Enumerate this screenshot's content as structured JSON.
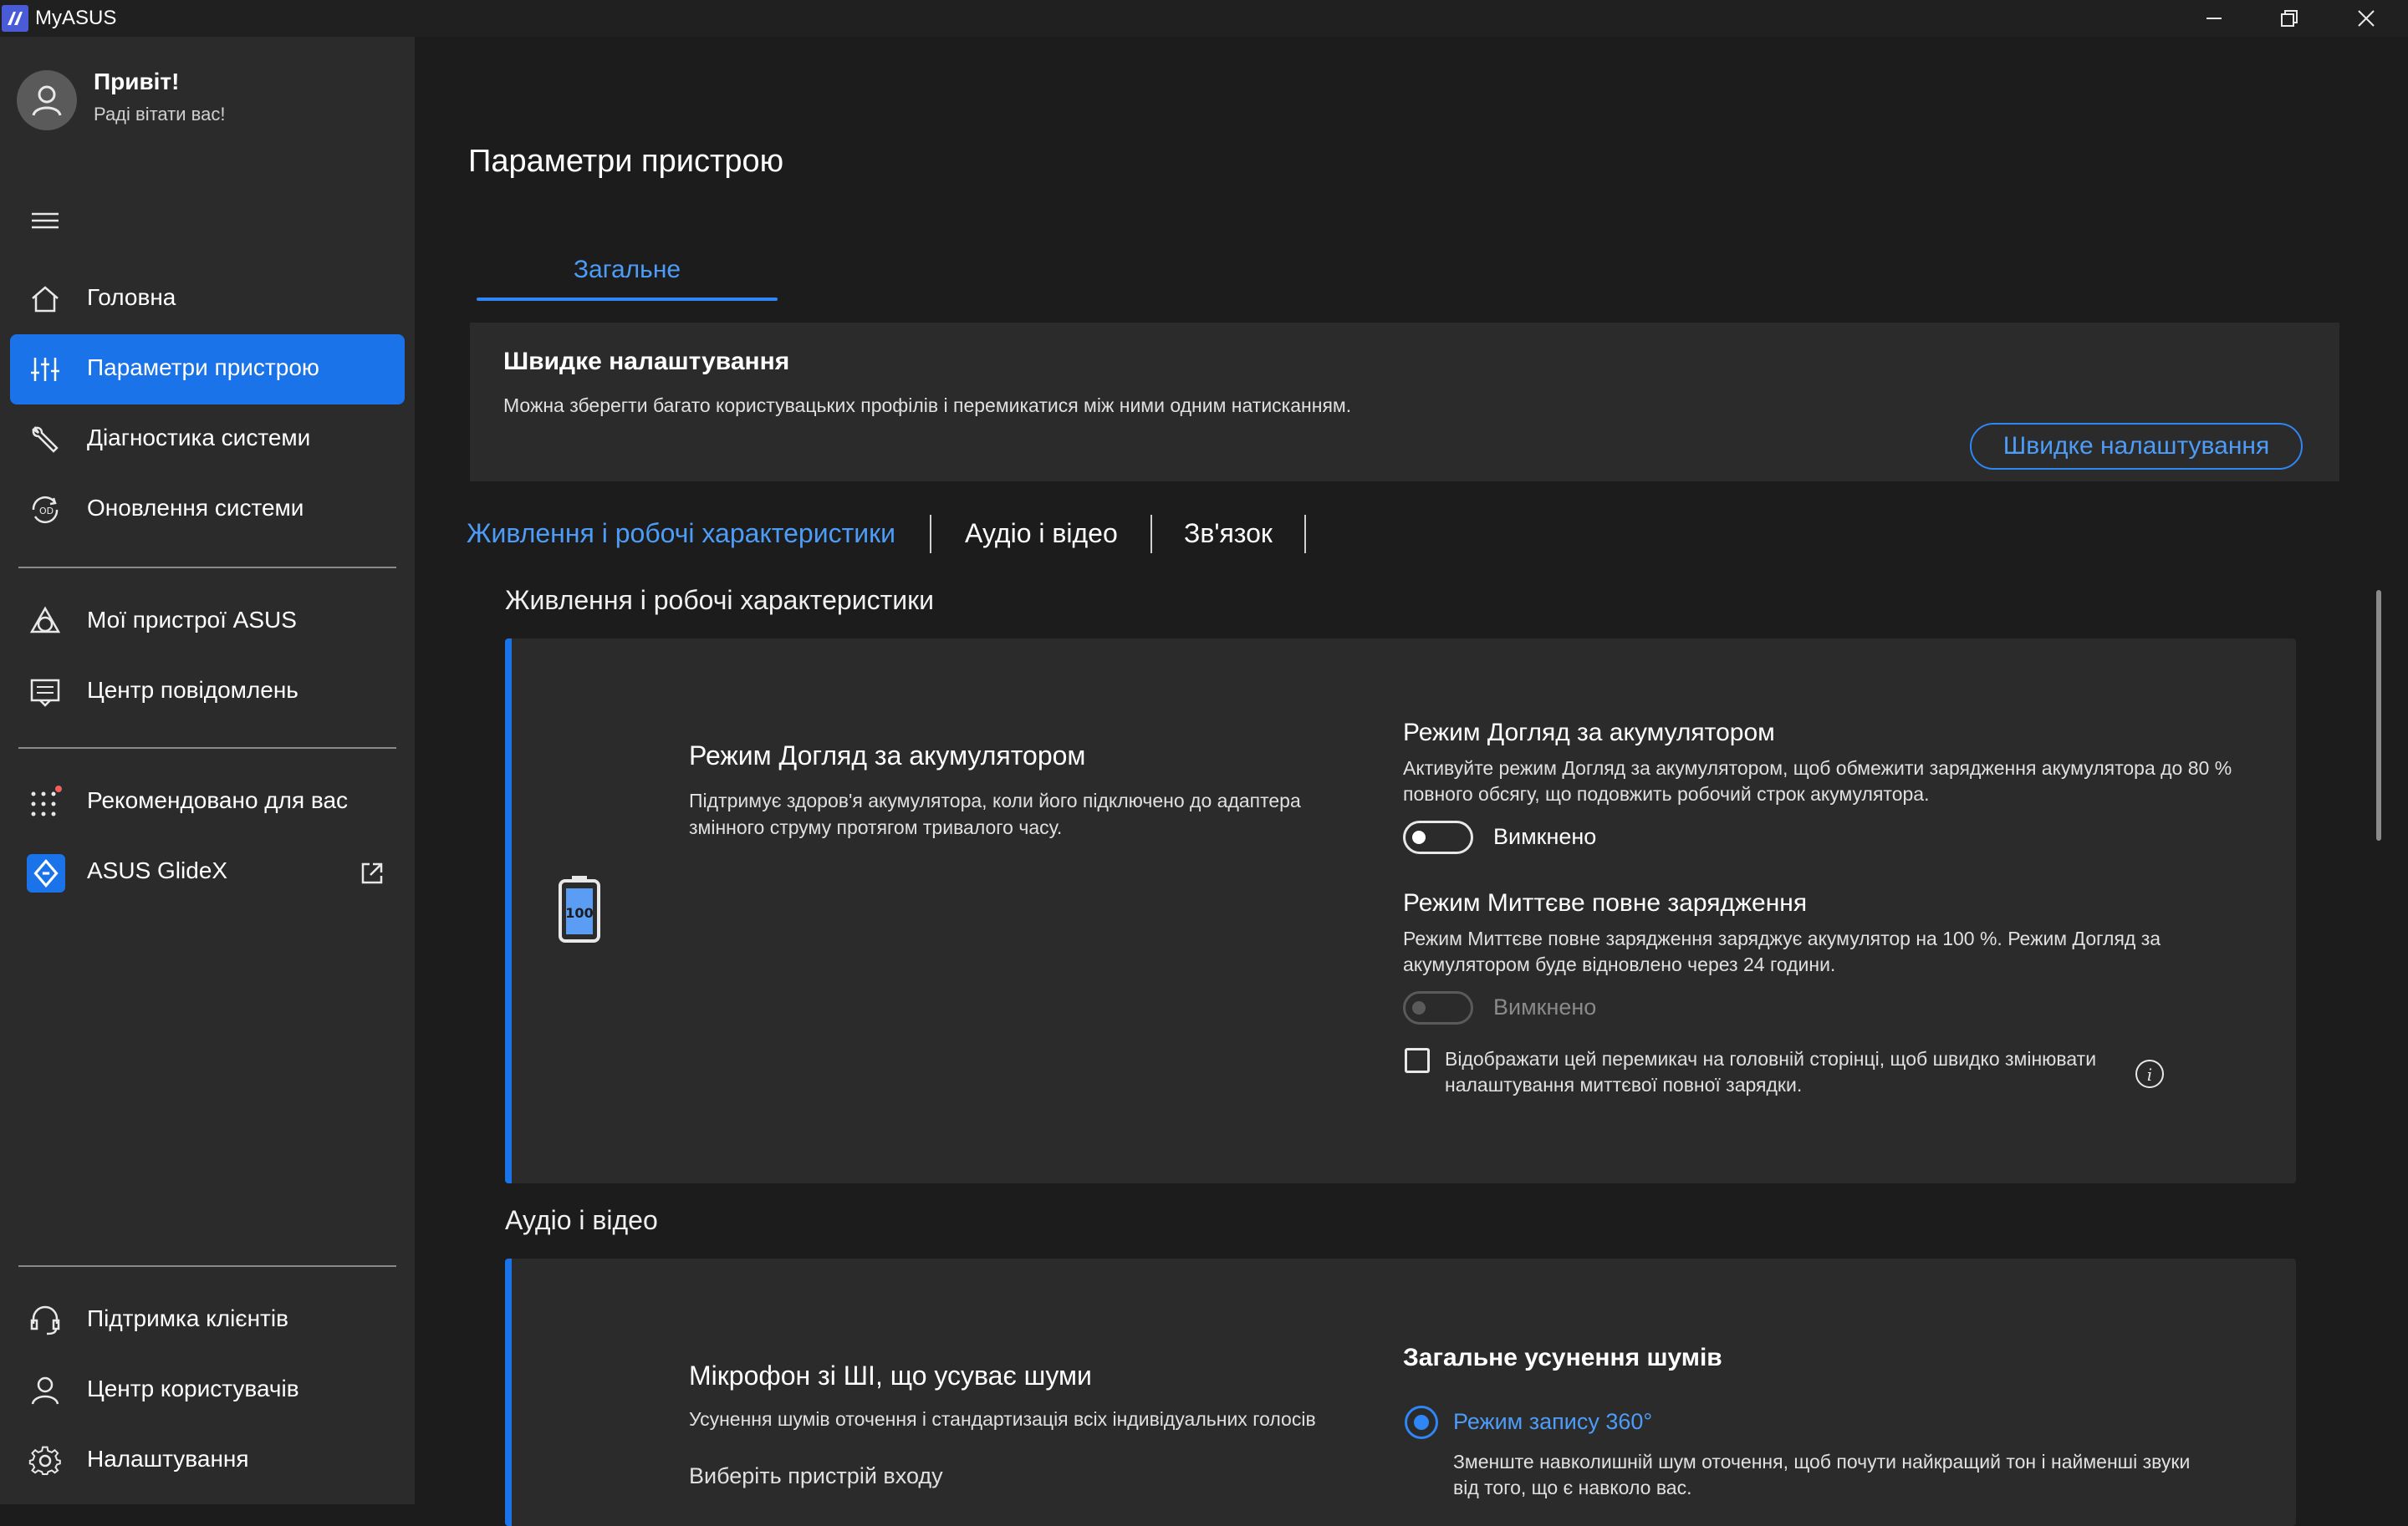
{
  "window": {
    "title": "MyASUS",
    "controls": [
      "minimize",
      "restore",
      "close"
    ]
  },
  "sidebar": {
    "greeting_title": "Привіт!",
    "greeting_sub": "Раді вітати вас!",
    "items": [
      {
        "label": "Головна",
        "icon": "home-icon",
        "active": false
      },
      {
        "label": "Параметри пристрою",
        "icon": "sliders-icon",
        "active": true
      },
      {
        "label": "Діагностика системи",
        "icon": "wrench-icon",
        "active": false
      },
      {
        "label": "Оновлення системи",
        "icon": "update-icon",
        "active": false
      },
      {
        "label": "Мої пристрої ASUS",
        "icon": "devices-icon",
        "active": false
      },
      {
        "label": "Центр повідомлень",
        "icon": "message-icon",
        "active": false
      },
      {
        "label": "Рекомендовано для вас",
        "icon": "grid-dots-icon",
        "active": false,
        "badge": true
      },
      {
        "label": "ASUS GlideX",
        "icon": "glidex-icon",
        "active": false,
        "external": true
      },
      {
        "label": "Підтримка клієнтів",
        "icon": "headset-icon",
        "active": false
      },
      {
        "label": "Центр користувачів",
        "icon": "user-icon",
        "active": false
      },
      {
        "label": "Налаштування",
        "icon": "gear-icon",
        "active": false
      }
    ]
  },
  "main": {
    "page_title": "Параметри пристрою",
    "tab_general": "Загальне",
    "quick": {
      "title": "Швидке налаштування",
      "description": "Можна зберегти багато користувацьких профілів і перемикатися між ними одним натисканням.",
      "button": "Швидке налаштування"
    },
    "subtabs": [
      "Живлення і робочі характеристики",
      "Аудіо і відео",
      "Зв'язок"
    ],
    "power_section": {
      "title": "Живлення і робочі характеристики",
      "feature_title": "Режим Догляд за акумулятором",
      "feature_desc": "Підтримує здоров'я акумулятора, коли його підключено до адаптера змінного струму протягом тривалого часу.",
      "battery_value": "100",
      "care_title": "Режим Догляд за акумулятором",
      "care_desc": "Активуйте режим Догляд за акумулятором, щоб обмежити зарядження акумулятора до 80 % повного обсягу, що подовжить робочий строк акумулятора.",
      "care_toggle": "Вимкнено",
      "instant_title": "Режим Миттєве повне зарядження",
      "instant_desc": "Режим Миттєве повне зарядження заряджує акумулятор на 100 %. Режим Догляд за акумулятором буде відновлено через 24 години.",
      "instant_toggle": "Вимкнено",
      "checkbox_label": "Відображати цей перемикач на головній сторінці, щоб швидко змінювати налаштування миттєвої повної зарядки."
    },
    "audio_section": {
      "title": "Аудіо і відео",
      "feature_title": "Мікрофон зі ШІ, що усуває шуми",
      "feature_desc": "Усунення шумів оточення і стандартизація всіх індивідуальних голосів",
      "input_label": "Виберіть пристрій входу",
      "noise_title": "Загальне усунення шумів",
      "radio_label": "Режим запису 360°",
      "radio_desc": "Зменште навколишній шум оточення, щоб почути найкращий тон і найменші звуки від того, що є навколо вас."
    }
  },
  "colors": {
    "accent": "#1a73e8",
    "accent_text": "#4d9cf8",
    "background": "#1c1c1c",
    "panel": "#2b2b2b"
  }
}
